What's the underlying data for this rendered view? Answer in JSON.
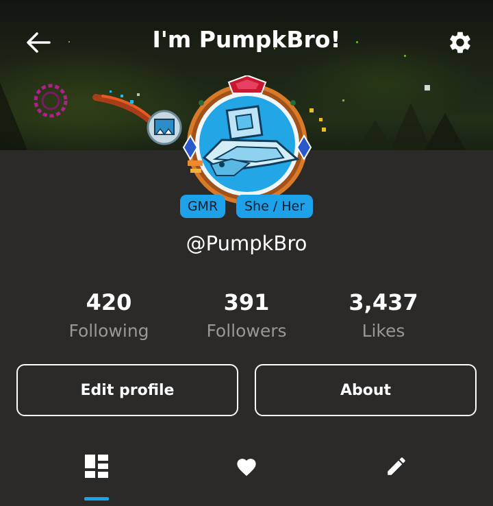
{
  "header": {
    "title": "I'm PumpkBro!",
    "back_icon": "arrow-left-icon",
    "settings_icon": "gear-icon"
  },
  "profile": {
    "badges": [
      "GMR",
      "She / Her"
    ],
    "username": "@PumpkBro"
  },
  "stats": [
    {
      "value": "420",
      "label": "Following"
    },
    {
      "value": "391",
      "label": "Followers"
    },
    {
      "value": "3,437",
      "label": "Likes"
    }
  ],
  "actions": {
    "edit_label": "Edit profile",
    "about_label": "About"
  },
  "tabs": [
    {
      "icon": "dashboard-grid-icon",
      "active": true
    },
    {
      "icon": "heart-icon",
      "active": false
    },
    {
      "icon": "pencil-icon",
      "active": false
    }
  ],
  "colors": {
    "background": "#2b2a29",
    "accent": "#1da1e8",
    "muted_text": "#9a9896",
    "text": "#ffffff"
  }
}
